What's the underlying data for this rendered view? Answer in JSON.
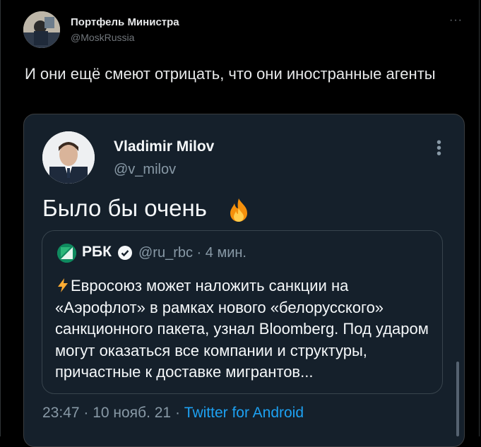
{
  "tweet": {
    "author_name": "Портфель Министра",
    "author_handle": "@MoskRussia",
    "more_label": "···",
    "text": "И они ещё смеют отрицать, что они иностранные агенты"
  },
  "embedded_tweet": {
    "author_name": "Vladimir Milov",
    "author_handle": "@v_milov",
    "text": "Было бы очень",
    "emoji_icon": "fire-icon",
    "quoted": {
      "author_name": "РБК",
      "meta": "@ru_rbc · 4 мин.",
      "verified_icon": "verified-icon",
      "text": "Евросоюз может наложить санкции на «Аэрофлот» в рамках нового «белорусского» санкционного пакета, узнал Bloomberg. Под ударом могут оказаться все компании и структуры, причастные к доставке мигрантов..."
    },
    "timestamp": "23:47 · 10 нояб. 21 · ",
    "source": "Twitter for Android"
  },
  "colors": {
    "background": "#000000",
    "embed_background": "#15202b",
    "link": "#1da1f2",
    "muted": "#8899a6"
  }
}
